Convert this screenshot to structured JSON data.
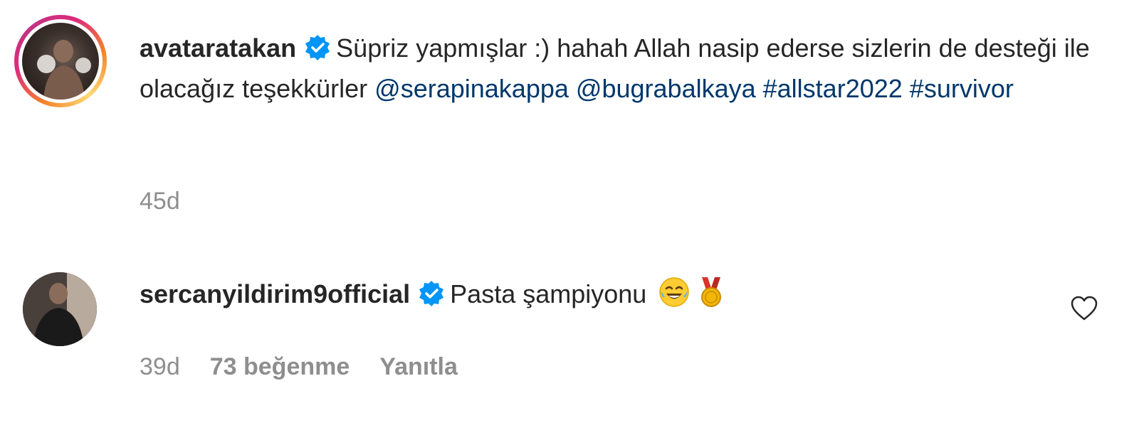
{
  "caption": {
    "username": "avataratakan",
    "text_1": "Süpriz yapmışlar :) hahah Allah nasip ederse sizlerin de desteği ile olacağız teşekkürler",
    "mentions": [
      "@serapinakappa",
      "@bugrabalkaya"
    ],
    "hashtags": [
      "#allstar2022",
      "#survivor"
    ],
    "time": "45d",
    "icons": [
      "verified-badge-icon"
    ]
  },
  "reply": {
    "username": "sercanyildirim9official",
    "text": "Pasta şampiyonu",
    "emojis": [
      "tears-of-joy-emoji",
      "medal-emoji"
    ],
    "time": "39d",
    "likes": "73 beğenme",
    "reply_label": "Yanıtla",
    "icons": [
      "verified-badge-icon",
      "heart-icon"
    ]
  },
  "colors": {
    "text": "#262626",
    "link": "#00376b",
    "meta": "#8e8e8e",
    "verified": "#0095f6"
  }
}
